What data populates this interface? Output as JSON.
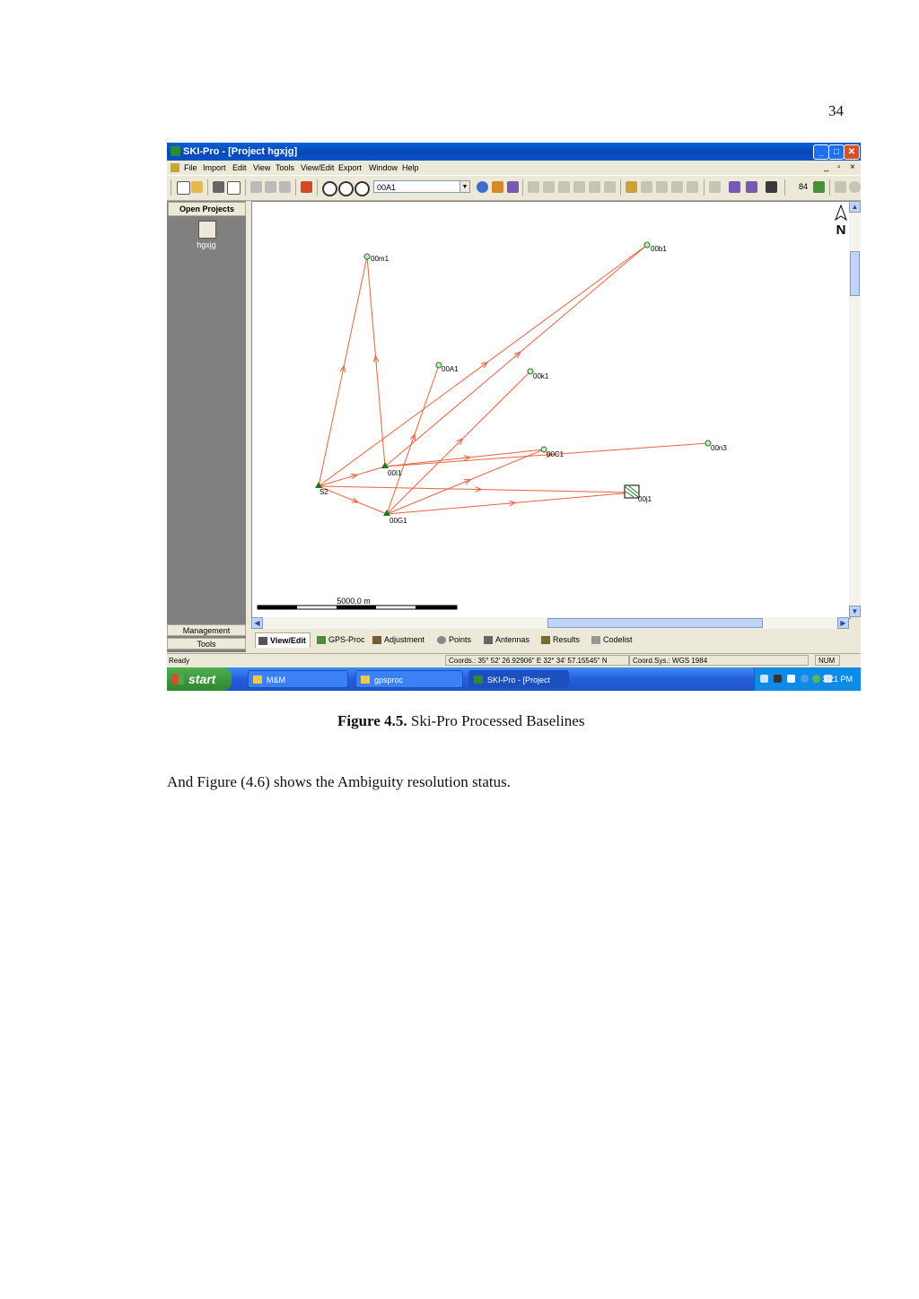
{
  "page_number": "34",
  "window": {
    "title": "SKI-Pro - [Project hgxjg]",
    "menu": [
      "File",
      "Import",
      "Edit",
      "View",
      "Tools",
      "View/Edit",
      "Export",
      "Window",
      "Help"
    ],
    "toolbar": {
      "point_select": "00A1",
      "count": "84"
    }
  },
  "sidebar": {
    "header": "Open Projects",
    "project": "hgxjg",
    "management": "Management",
    "tools": "Tools"
  },
  "map": {
    "north": "N",
    "scale_label": "5000.0 m",
    "points": [
      {
        "id": "p-00m1",
        "label": "00m1",
        "type": "circle"
      },
      {
        "id": "p-00b1",
        "label": "00b1",
        "type": "circle"
      },
      {
        "id": "p-00a1",
        "label": "00A1",
        "type": "circle"
      },
      {
        "id": "p-00k1",
        "label": "00k1",
        "type": "circle"
      },
      {
        "id": "p-00c1",
        "label": "00C1",
        "type": "circle"
      },
      {
        "id": "p-00n3",
        "label": "00n3",
        "type": "circle"
      },
      {
        "id": "p-00i1",
        "label": "00I1",
        "type": "triangle"
      },
      {
        "id": "p-s2",
        "label": "S2",
        "type": "triangle"
      },
      {
        "id": "p-00g1",
        "label": "00G1",
        "type": "triangle"
      },
      {
        "id": "p-00j1",
        "label": "00j1",
        "type": "selected"
      }
    ],
    "line_color": "#e8623f"
  },
  "tabs": [
    "View/Edit",
    "GPS-Proc",
    "Adjustment",
    "Points",
    "Antennas",
    "Results",
    "Codelist"
  ],
  "status": {
    "ready": "Ready",
    "coords": "Coords.:  35° 52' 26.92906\" E   32° 34' 57.15545\" N",
    "coord_sys": "Coord.Sys.: WGS 1984",
    "num": "NUM"
  },
  "taskbar": {
    "start": "start",
    "items": [
      "M&M",
      "gpsproc",
      "SKI-Pro - [Project hg..."
    ],
    "clock": "3:21 PM"
  },
  "caption": {
    "label": "Figure 4.5.",
    "text": " Ski-Pro Processed Baselines"
  },
  "body_text": "And Figure (4.6) shows the Ambiguity resolution status."
}
